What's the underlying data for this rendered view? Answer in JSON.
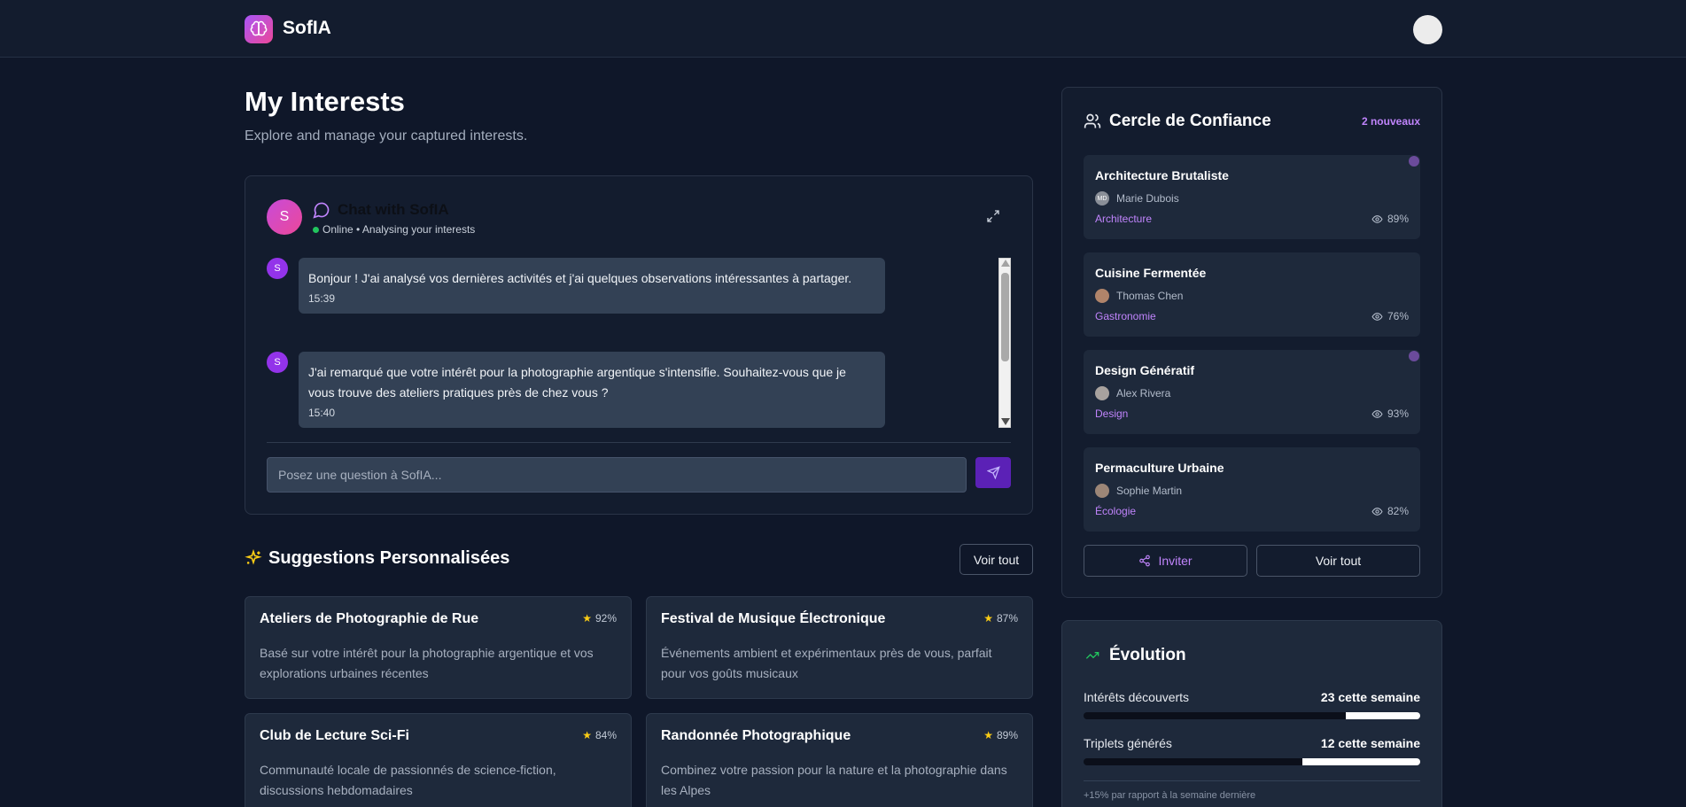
{
  "app": {
    "brand": "SofIA"
  },
  "page": {
    "title": "My Interests",
    "subtitle": "Explore and manage your captured interests."
  },
  "chat": {
    "avatar_letter": "S",
    "title": "Chat with SofIA",
    "status": "Online • Analysing your interests",
    "messages": [
      {
        "avatar": "S",
        "text": "Bonjour ! J'ai analysé vos dernières activités et j'ai quelques observations intéressantes à partager.",
        "time": "15:39"
      },
      {
        "avatar": "S",
        "text": "J'ai remarqué que votre intérêt pour la photographie argentique s'intensifie. Souhaitez-vous que je vous trouve des ateliers pratiques près de chez vous ?",
        "time": "15:40"
      }
    ],
    "input_placeholder": "Posez une question à SofIA..."
  },
  "suggestions": {
    "title": "Suggestions Personnalisées",
    "view_all": "Voir tout",
    "items": [
      {
        "title": "Ateliers de Photographie de Rue",
        "score": "92%",
        "desc": "Basé sur votre intérêt pour la photographie argentique et vos explorations urbaines récentes"
      },
      {
        "title": "Festival de Musique Électronique",
        "score": "87%",
        "desc": "Événements ambient et expérimentaux près de vous, parfait pour vos goûts musicaux"
      },
      {
        "title": "Club de Lecture Sci-Fi",
        "score": "84%",
        "desc": "Communauté locale de passionnés de science-fiction, discussions hebdomadaires"
      },
      {
        "title": "Randonnée Photographique",
        "score": "89%",
        "desc": "Combinez votre passion pour la nature et la photographie dans les Alpes"
      }
    ]
  },
  "trust": {
    "title": "Cercle de Confiance",
    "new_badge": "2 nouveaux",
    "items": [
      {
        "title": "Architecture Brutaliste",
        "person": "Marie Dubois",
        "initials": "MD",
        "category": "Architecture",
        "views": "89%",
        "unread": true
      },
      {
        "title": "Cuisine Fermentée",
        "person": "Thomas Chen",
        "initials": "",
        "category": "Gastronomie",
        "views": "76%",
        "unread": false
      },
      {
        "title": "Design Génératif",
        "person": "Alex Rivera",
        "initials": "",
        "category": "Design",
        "views": "93%",
        "unread": true
      },
      {
        "title": "Permaculture Urbaine",
        "person": "Sophie Martin",
        "initials": "",
        "category": "Écologie",
        "views": "82%",
        "unread": false
      }
    ],
    "invite": "Inviter",
    "view_all": "Voir tout"
  },
  "evolution": {
    "title": "Évolution",
    "rows": [
      {
        "label": "Intérêts découverts",
        "value": "23 cette semaine",
        "progress": 0.22
      },
      {
        "label": "Triplets générés",
        "value": "12 cette semaine",
        "progress": 0.35
      }
    ],
    "note": "+15% par rapport à la semaine dernière"
  },
  "colors": {
    "accent": "#c084fc",
    "bg": "#0f1729",
    "panel": "#131c2e",
    "card": "#1e293b",
    "send": "#5b21b6"
  }
}
